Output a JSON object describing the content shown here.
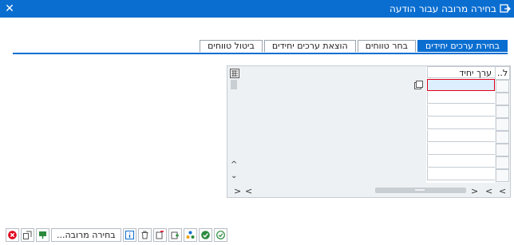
{
  "window": {
    "title": "בחירה מרובה עבור הודעה"
  },
  "tabs": [
    {
      "label": "בחירת ערכים יחידים",
      "active": true
    },
    {
      "label": "בחר טווחים",
      "active": false
    },
    {
      "label": "הוצאת ערכים יחידים",
      "active": false
    },
    {
      "label": "ביטול טווחים",
      "active": false
    }
  ],
  "table": {
    "columns": {
      "row_selector": "ל..",
      "value": "ערך יחיד"
    },
    "rows": [
      "",
      "",
      "",
      "",
      "",
      "",
      "",
      ""
    ]
  },
  "toolbar": {
    "multiple_selection_label": "בחירה מרובה..."
  },
  "colors": {
    "accent": "#0a6ed1",
    "error": "#e0001b",
    "ok": "#2b8a3e"
  }
}
